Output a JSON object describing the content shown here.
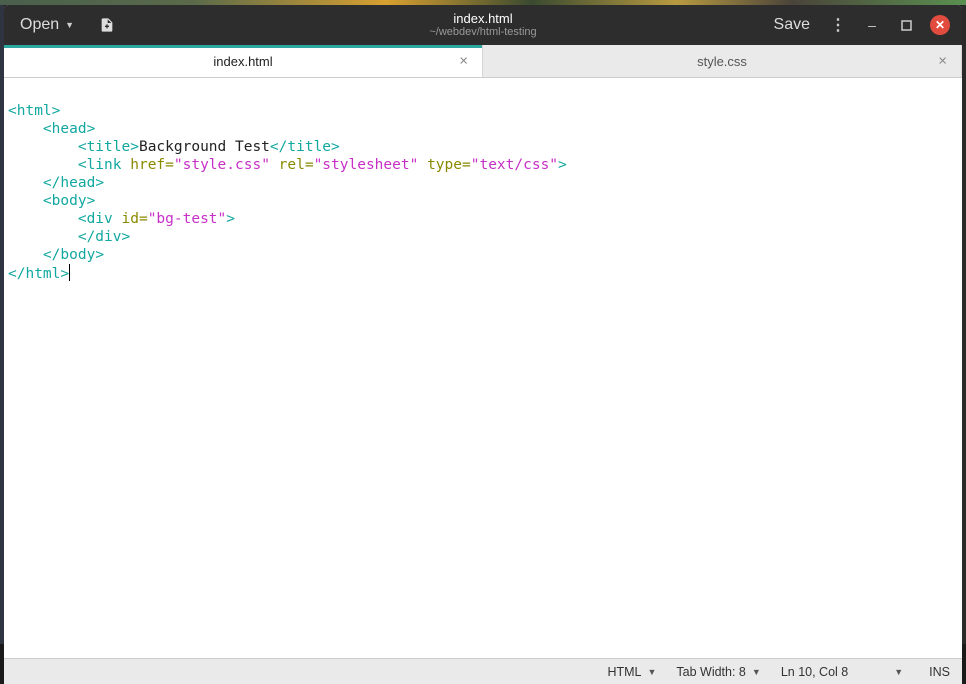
{
  "header": {
    "open_label": "Open",
    "save_label": "Save",
    "title": "index.html",
    "subtitle": "~/webdev/html-testing"
  },
  "tabs": [
    {
      "label": "index.html",
      "active": true
    },
    {
      "label": "style.css",
      "active": false
    }
  ],
  "code": {
    "l1": {
      "tag_open": "<html",
      "tag_close": ">"
    },
    "l2": {
      "tag_open": "<head",
      "tag_close": ">"
    },
    "l3": {
      "tag_open": "<title",
      "gt": ">",
      "text": "Background Test",
      "tag_close_open": "</title",
      "tag_close_gt": ">"
    },
    "l4": {
      "tag_open": "<link",
      "attr1": " href=",
      "str1": "\"style.css\"",
      "attr2": " rel=",
      "str2": "\"stylesheet\"",
      "attr3": " type=",
      "str3": "\"text/css\"",
      "gt": ">"
    },
    "l5": {
      "tag_open": "</head",
      "tag_close": ">"
    },
    "l6": {
      "tag_open": "<body",
      "tag_close": ">"
    },
    "l7": {
      "tag_open": "<div",
      "attr1": " id=",
      "str1": "\"bg-test\"",
      "gt": ">"
    },
    "l8": {
      "tag_open": "</div",
      "tag_close": ">"
    },
    "l9": {
      "tag_open": "</body",
      "tag_close": ">"
    },
    "l10": {
      "tag_open": "</html",
      "tag_close": ">"
    }
  },
  "status": {
    "language": "HTML",
    "tab_width": "Tab Width: 8",
    "position": "Ln 10, Col 8",
    "mode": "INS"
  }
}
